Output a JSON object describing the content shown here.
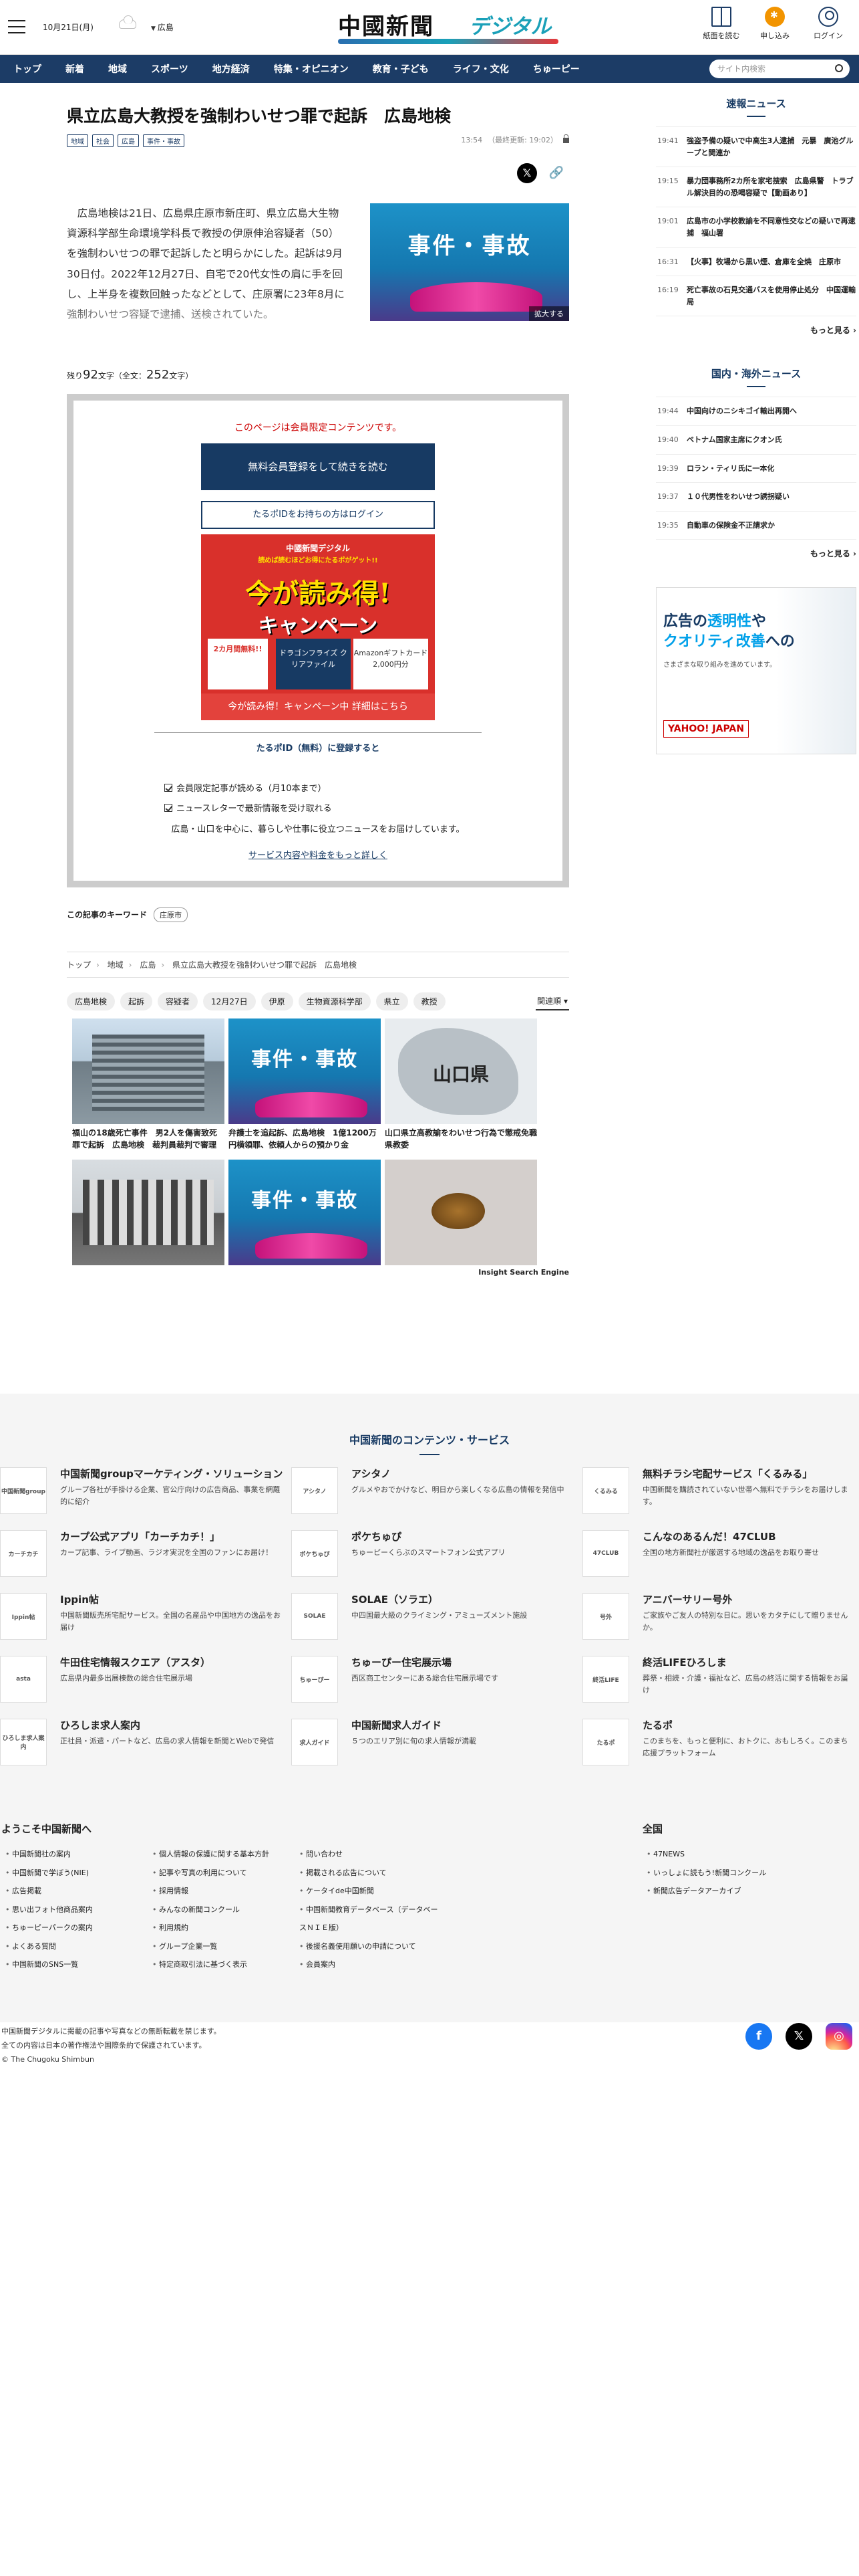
{
  "header": {
    "date": "10月21日(月)",
    "region": "広島",
    "logo_ja": "中國新聞",
    "logo_digital": "デジタル",
    "icons": [
      {
        "label": "紙面を読む",
        "icon": "book-icon"
      },
      {
        "label": "申し込み",
        "icon": "subscribe-icon"
      },
      {
        "label": "ログイン",
        "icon": "user-icon"
      }
    ]
  },
  "nav": {
    "items": [
      "トップ",
      "新着",
      "地域",
      "スポーツ",
      "地方経済",
      "特集・オピニオン",
      "教育・子ども",
      "ライフ・文化",
      "ちゅーピー"
    ],
    "search_placeholder": "サイト内検索"
  },
  "article": {
    "title": "県立広島大教授を強制わいせつ罪で起訴　広島地検",
    "tags": [
      "地域",
      "社会",
      "広島",
      "事件・事故"
    ],
    "time": "13:54",
    "updated": "（最終更新: 19:02）",
    "body": "広島地検は21日、広島県庄原市新庄町、県立広島大生物資源科学部生命環境学科長で教授の伊原伸治容疑者（50）を強制わいせつの罪で起訴したと明らかにした。起訴は9月30日付。2022年12月27日、自宅で20代女性の肩に手を回し、上半身を複数回触ったなどとして、庄原署に23年8月に強制わいせつ容疑で逮捕、送検されていた。",
    "photo_label": "事件・事故",
    "enlarge": "拡大する",
    "remain_prefix": "残り",
    "remain_num": "92",
    "remain_suffix": "文字（全文：",
    "total_num": "252",
    "total_suffix": "文字）"
  },
  "paywall": {
    "lead": "このページは会員限定コンテンツです。",
    "btn_register": "無料会員登録をして続きを読む",
    "btn_login": "たるポIDをお持ちの方はログイン",
    "banner": {
      "line1": "中國新聞デジタル",
      "line2": "読めば読むほどお得にたるポがゲット!!",
      "big1": "今が読み得!",
      "big2": "キャンペーン",
      "box1": "2カ月間無料!!",
      "box2": "ドラゴンフライズ クリアファイル",
      "box3": "Amazonギフトカード2,000円分",
      "caption": "今が読み得！キャンペーン中 詳細はこちら"
    },
    "id_title": "たるポID（無料）に登録すると",
    "benefits": [
      "会員限定記事が読める（月10本まで）",
      "ニュースレターで最新情報を受け取れる"
    ],
    "note": "広島・山口を中心に、暮らしや仕事に役立つニュースをお届けしています。",
    "link": "サービス内容や料金をもっと詳しく"
  },
  "keyword": {
    "label": "この記事のキーワード",
    "tag": "庄原市"
  },
  "breadcrumb": [
    "トップ",
    "地域",
    "広島",
    "県立広島大教授を強制わいせつ罪で起訴　広島地検"
  ],
  "chips": [
    "広島地検",
    "起訴",
    "容疑者",
    "12月27日",
    "伊原",
    "生物資源科学部",
    "県立",
    "教授"
  ],
  "related_label": "関連順",
  "thumbs": [
    {
      "cap": "福山の18歳死亡事件　男2人を傷害致死罪で起訴　広島地検　裁判員裁判で審理",
      "type": "bld"
    },
    {
      "cap": "弁護士を追起訴、広島地検　1億1200万円横領罪、依頼人からの預かり金",
      "type": "jiko",
      "label": "事件・事故"
    },
    {
      "cap": "山口県立高教諭をわいせつ行為で懲戒免職　県教委",
      "type": "map",
      "label": "山口県"
    },
    {
      "cap": "",
      "type": "bld2"
    },
    {
      "cap": "",
      "type": "jiko",
      "label": "事件・事故"
    },
    {
      "cap": "",
      "type": "bug"
    }
  ],
  "ise": "Insight Search Engine",
  "side": {
    "breaking_title": "速報ニュース",
    "breaking": [
      {
        "t": "19:41",
        "h": "強盗予備の疑いで中高生3人逮捕　元暴　廣池グループと関連か"
      },
      {
        "t": "19:15",
        "h": "暴力団事務所2カ所を家宅捜索　広島県警　トラブル解決目的の恐喝容疑で【動画あり】"
      },
      {
        "t": "19:01",
        "h": "広島市の小学校教諭を不同意性交などの疑いで再逮捕　福山署"
      },
      {
        "t": "16:31",
        "h": "【火事】牧場から黒い煙、倉庫を全焼　庄原市"
      },
      {
        "t": "16:19",
        "h": "死亡事故の石見交通バスを使用停止処分　中国運輸局"
      }
    ],
    "more": "もっと見る",
    "world_title": "国内・海外ニュース",
    "world": [
      {
        "t": "19:44",
        "h": "中国向けのニシキゴイ輸出再開へ"
      },
      {
        "t": "19:40",
        "h": "ベトナム国家主席にクオン氏"
      },
      {
        "t": "19:39",
        "h": "ロラン・ティリ氏に一本化"
      },
      {
        "t": "19:37",
        "h": "１０代男性をわいせつ誘拐疑い"
      },
      {
        "t": "19:35",
        "h": "自動車の保険金不正請求か"
      }
    ],
    "ad": {
      "l1a": "広告の",
      "l1b": "透明性",
      "l1c": "や",
      "l2a": "クオリティ改善",
      "l2b": "への",
      "sub": "さまざまな取り組みを進めています。",
      "brand": "YAHOO! JAPAN"
    }
  },
  "footer": {
    "title": "中国新聞のコンテンツ・サービス",
    "services": [
      {
        "n": "中国新聞groupマーケティング・ソリューション",
        "d": "グループ各社が手掛ける企業、官公庁向けの広告商品、事業を網羅的に紹介",
        "logo": "中国新聞group"
      },
      {
        "n": "アシタノ",
        "d": "グルメやおでかけなど、明日から楽しくなる広島の情報を発信中",
        "logo": "アシタノ"
      },
      {
        "n": "無料チラシ宅配サービス「くるみる」",
        "d": "中国新聞を購読されていない世帯へ無料でチラシをお届けします。",
        "logo": "くるみる"
      },
      {
        "n": "カープ公式アプリ「カーチカチ！」",
        "d": "カープ記事、ライブ動画、ラジオ実況を全国のファンにお届け！",
        "logo": "カーチカチ"
      },
      {
        "n": "ポケちゅぴ",
        "d": "ちゅーピーくらぶのスマートフォン公式アプリ",
        "logo": "ポケちゅぴ"
      },
      {
        "n": "こんなのあるんだ！47CLUB",
        "d": "全国の地方新聞社が厳選する地域の逸品をお取り寄せ",
        "logo": "47CLUB"
      },
      {
        "n": "Ippin帖",
        "d": "中国新聞販売所宅配サービス。全国の名産品や中国地方の逸品をお届け",
        "logo": "Ippin帖"
      },
      {
        "n": "SOLAE（ソラエ）",
        "d": "中四国最大級のクライミング・アミューズメント施設",
        "logo": "SOLAE"
      },
      {
        "n": "アニバーサリー号外",
        "d": "ご家族やご友人の特別な日に。思いをカタチにして贈りませんか。",
        "logo": "号外"
      },
      {
        "n": "牛田住宅情報スクエア（アスタ）",
        "d": "広島県内最多出展棟数の総合住宅展示場",
        "logo": "asta"
      },
      {
        "n": "ちゅーぴー住宅展示場",
        "d": "西区商工センターにある総合住宅展示場です",
        "logo": "ちゅーぴー"
      },
      {
        "n": "終活LIFEひろしま",
        "d": "葬祭・相続・介護・福祉など、広島の終活に関する情報をお届け",
        "logo": "終活LIFE"
      },
      {
        "n": "ひろしま求人案内",
        "d": "正社員・派遣・パートなど、広島の求人情報を新聞とWebで発信",
        "logo": "ひろしま求人案内"
      },
      {
        "n": "中国新聞求人ガイド",
        "d": "５つのエリア別に旬の求人情報が満載",
        "logo": "求人ガイド"
      },
      {
        "n": "たるポ",
        "d": "このまちを、もっと便利に、おトクに、おもしろく。このまち応援プラットフォーム",
        "logo": "たるポ"
      }
    ],
    "welcome_title": "ようこそ中国新聞へ",
    "welcome_cols": [
      [
        "中国新聞社の案内",
        "中国新聞で学ぼう(NIE)",
        "広告掲載",
        "思い出フォト他商品案内",
        "ちゅーピーパークの案内",
        "よくある質問",
        "中国新聞のSNS一覧"
      ],
      [
        "個人情報の保護に関する基本方針",
        "記事や写真の利用について",
        "採用情報",
        "みんなの新聞コンクール",
        "利用規約",
        "グループ企業一覧",
        "特定商取引法に基づく表示"
      ],
      [
        "問い合わせ",
        "掲載される広告について",
        "ケータイde中国新聞",
        "中国新聞教育データベース（データベースＮＩＥ版）",
        "後援名義使用願いの申請について",
        "会員案内"
      ]
    ],
    "zenkoku_title": "全国",
    "zenkoku": [
      "47NEWS",
      "いっしょに読もう!新聞コンクール",
      "新聞広告データアーカイブ"
    ],
    "copyright": [
      "中国新聞デジタルに掲載の記事や写真などの無断転載を禁じます。",
      "全ての内容は日本の著作権法や国際条約で保護されています。",
      "© The Chugoku Shimbun"
    ]
  }
}
